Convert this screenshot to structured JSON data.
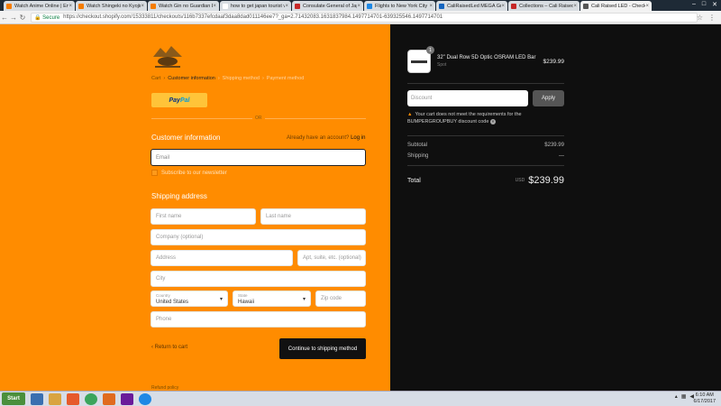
{
  "browser": {
    "tabs": [
      {
        "label": "Watch Anime Online | Eng",
        "color": "#f57c00"
      },
      {
        "label": "Watch Shingeki no Kyojin",
        "color": "#f57c00"
      },
      {
        "label": "Watch Gin no Guardian Ep",
        "color": "#f57c00"
      },
      {
        "label": "how to get japan tourist vi",
        "color": "#ffffff"
      },
      {
        "label": "Consulate General of Japa",
        "color": "#c62828"
      },
      {
        "label": "Flights to New York City",
        "color": "#1e88e5"
      },
      {
        "label": "CaliRaisedLed MEGA Grou",
        "color": "#1565c0"
      },
      {
        "label": "Collections – Cali Raised L",
        "color": "#c62828"
      },
      {
        "label": "Cali Raised LED - Checkout",
        "color": "#555555"
      }
    ],
    "window_controls": [
      "–",
      "□",
      "✕"
    ],
    "secure_label": "Secure",
    "url": "https://checkout.shopify.com/15333811/checkouts/116b7337efcdaaf3daa8dad011146ee7?_ga=2.71432083.1631837984.1497714701-639325546.1497714701",
    "nav": {
      "back": "←",
      "forward": "→",
      "reload": "↻"
    },
    "star": "☆",
    "menu": "⋮"
  },
  "breadcrumb": {
    "items": [
      "Cart",
      "Customer information",
      "Shipping method",
      "Payment method"
    ],
    "separator": "›"
  },
  "paypal": {
    "pay": "Pay",
    "pal": "Pal"
  },
  "or_text": "OR",
  "customer": {
    "heading": "Customer information",
    "login_prompt": "Already have an account?",
    "login_link": "Log in",
    "email_placeholder": "Email",
    "subscribe_label": "Subscribe to our newsletter"
  },
  "shipping": {
    "heading": "Shipping address",
    "first_name": "First name",
    "last_name": "Last name",
    "company": "Company (optional)",
    "address": "Address",
    "apt": "Apt, suite, etc. (optional)",
    "city": "City",
    "country_label": "Country",
    "country_value": "United States",
    "state_label": "State",
    "state_value": "Hawaii",
    "zip": "Zip code",
    "phone": "Phone"
  },
  "actions": {
    "return_to_cart": "Return to cart",
    "continue": "Continue to shipping method"
  },
  "footer": {
    "refund": "Refund policy"
  },
  "order": {
    "quantity": "1",
    "product_name": "32\" Dual Row 5D Optic OSRAM LED Bar",
    "product_variant": "Spot",
    "product_price": "$239.99",
    "discount_placeholder": "Discount",
    "apply_label": "Apply",
    "warning": "Your cart does not meet the requirements for the BUMPERGROUPBUY discount code",
    "subtotal_label": "Subtotal",
    "subtotal_value": "$239.99",
    "shipping_label": "Shipping",
    "shipping_value": "—",
    "total_label": "Total",
    "total_currency": "USD",
    "total_value": "$239.99"
  },
  "taskbar": {
    "start_label": "Start",
    "time": "6:10 AM",
    "date": "6/17/2017"
  },
  "colors": {
    "accent": "#ff8c00",
    "sidebar": "#0f0f0f",
    "paypal": "#ffc439"
  }
}
